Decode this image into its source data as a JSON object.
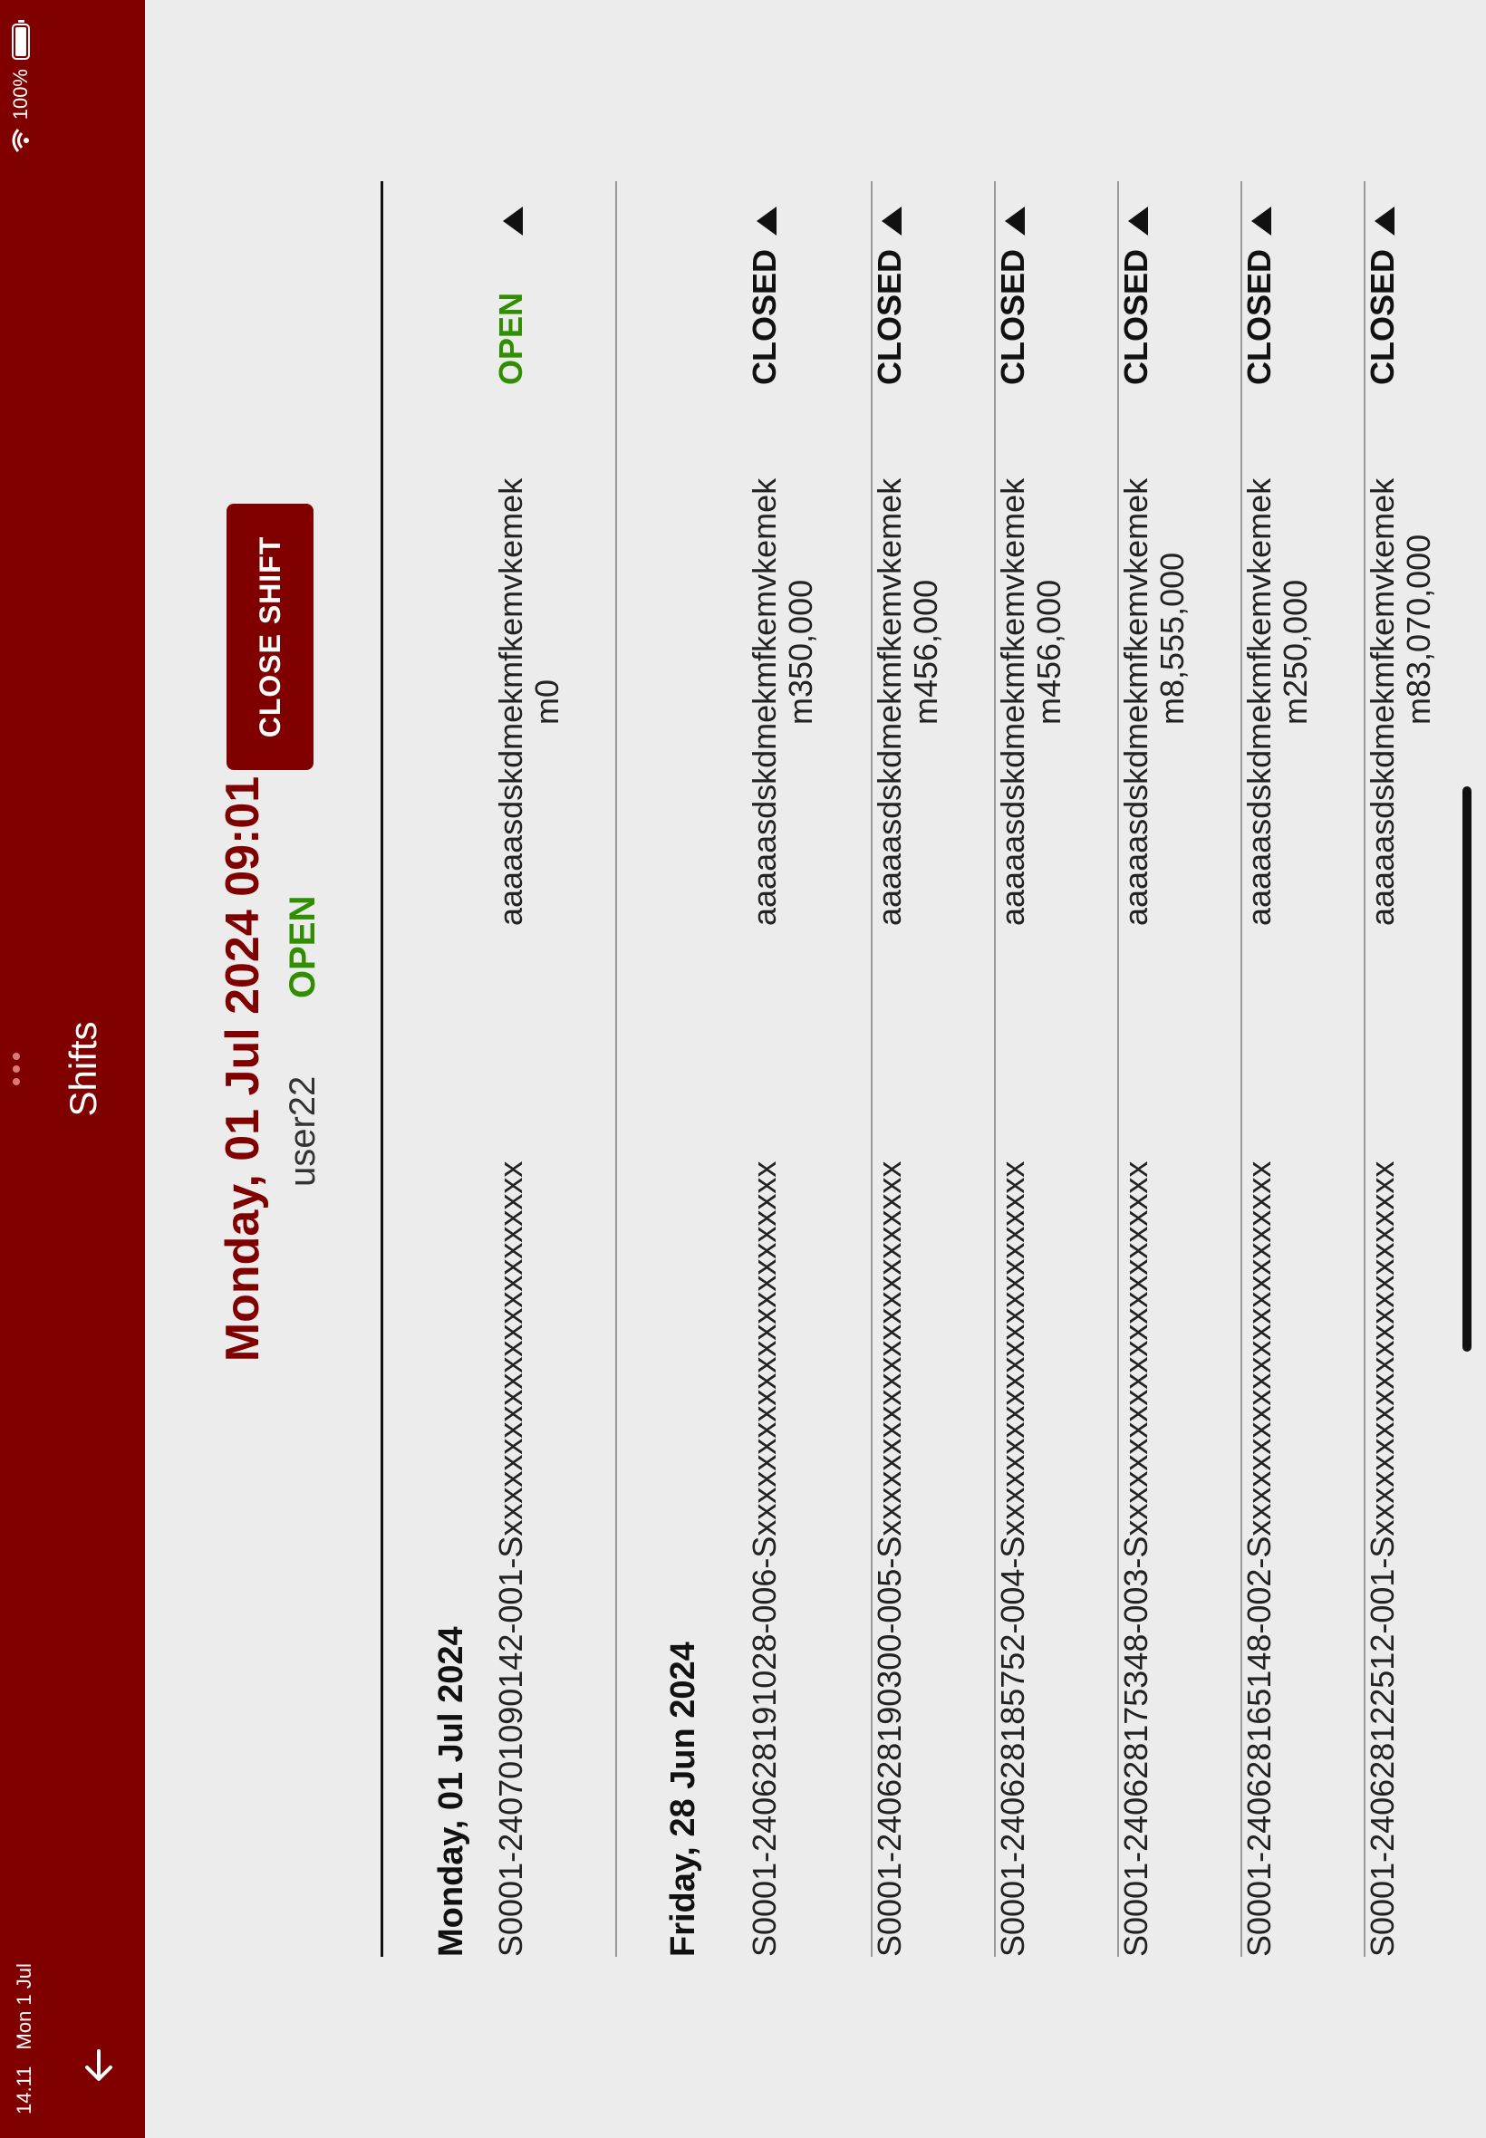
{
  "status_bar": {
    "time": "14.11",
    "date": "Mon 1 Jul",
    "battery": "100%"
  },
  "header": {
    "title": "Shifts",
    "back_icon": "back-arrow-icon",
    "more_icon": "more-dots-icon"
  },
  "current_shift": {
    "datetime": "Monday, 01  Jul 2024 09:01",
    "user": "user22",
    "status": "OPEN",
    "close_button_label": "CLOSE SHIFT"
  },
  "colors": {
    "primary": "#800000",
    "open": "#2f8f00",
    "closed": "#111111",
    "background": "#ececec"
  },
  "sections": [
    {
      "date": "Monday, 01  Jul 2024",
      "rows": [
        {
          "id": "S0001-240701090142-001-Sxxxxxxxxxxxxxxxxxxxxxxx",
          "note": "aaaaasdskdmekmfkemvkemek",
          "amount": "m0",
          "status": "OPEN"
        }
      ]
    },
    {
      "date": "Friday, 28  Jun 2024",
      "rows": [
        {
          "id": "S0001-240628191028-006-Sxxxxxxxxxxxxxxxxxxxxxxx",
          "note": "aaaaasdskdmekmfkemvkemek",
          "amount": "m350,000",
          "status": "CLOSED"
        },
        {
          "id": "S0001-240628190300-005-Sxxxxxxxxxxxxxxxxxxxxxxx",
          "note": "aaaaasdskdmekmfkemvkemek",
          "amount": "m456,000",
          "status": "CLOSED"
        },
        {
          "id": "S0001-240628185752-004-Sxxxxxxxxxxxxxxxxxxxxxxx",
          "note": "aaaaasdskdmekmfkemvkemek",
          "amount": "m456,000",
          "status": "CLOSED"
        },
        {
          "id": "S0001-240628175348-003-Sxxxxxxxxxxxxxxxxxxxxxxx",
          "note": "aaaaasdskdmekmfkemvkemek",
          "amount": "m8,555,000",
          "status": "CLOSED"
        },
        {
          "id": "S0001-240628165148-002-Sxxxxxxxxxxxxxxxxxxxxxxx",
          "note": "aaaaasdskdmekmfkemvkemek",
          "amount": "m250,000",
          "status": "CLOSED"
        },
        {
          "id": "S0001-240628122512-001-Sxxxxxxxxxxxxxxxxxxxxxxx",
          "note": "aaaaasdskdmekmfkemvkemek",
          "amount": "m83,070,000",
          "status": "CLOSED"
        }
      ]
    }
  ]
}
